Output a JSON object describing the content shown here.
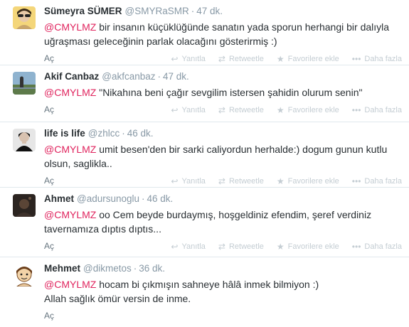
{
  "tweets": [
    {
      "fullname": "Sümeyra SÜMER",
      "username": "@SMYRaSMR",
      "time": "47 dk.",
      "mention": "@CMYLMZ",
      "line1": " bir insanın küçüklüğünde sanatın yada sporun herhangi bir dalıyla",
      "line2": "uğraşması geleceğinin parlak olacağını gösterirmiş :)",
      "expand": "Aç",
      "avatar": "girl-avatar"
    },
    {
      "fullname": "Akif Canbaz",
      "username": "@akfcanbaz",
      "time": "47 dk.",
      "mention": "@CMYLMZ",
      "line1": " \"Nikahına beni çağır sevgilim istersen şahidin olurum senin\"",
      "line2": "",
      "expand": "Aç",
      "avatar": "landscape-avatar"
    },
    {
      "fullname": "life is life",
      "username": "@zhlcc",
      "time": "46 dk.",
      "mention": "@CMYLMZ",
      "line1": " umit besen'den bir sarki caliyordun herhalde:) dogum gunun kutlu",
      "line2": "olsun, saglikla..",
      "expand": "Aç",
      "avatar": "portrait-avatar"
    },
    {
      "fullname": "Ahmet",
      "username": "@adursunoglu",
      "time": "46 dk.",
      "mention": "@CMYLMZ",
      "line1": " oo Cem beyde burdaymış, hoşgeldiniz efendim, şeref verdiniz",
      "line2": "tavernamıza dıptıs dıptıs...",
      "expand": "Aç",
      "avatar": "dark-avatar"
    },
    {
      "fullname": "Mehmet",
      "username": "@dikmetos",
      "time": "36 dk.",
      "mention": "@CMYLMZ",
      "line1": " hocam bi çıkmışın sahneye hâlâ inmek bilmiyon :)",
      "line2": "Allah sağlık ömür versin de inme.",
      "expand": "Aç",
      "avatar": "cartoon-avatar"
    }
  ],
  "actions": {
    "reply": "Yanıtla",
    "retweet": "Retweetle",
    "favorite": "Favorilere ekle",
    "more": "Daha fazla"
  },
  "sep": "·",
  "icons": {
    "reply": "reply-icon",
    "retweet": "retweet-icon",
    "favorite": "star-icon",
    "more": "more-icon"
  },
  "colors": {
    "mention": "#e0245e",
    "meta": "#8899a6",
    "text": "#292f33"
  }
}
